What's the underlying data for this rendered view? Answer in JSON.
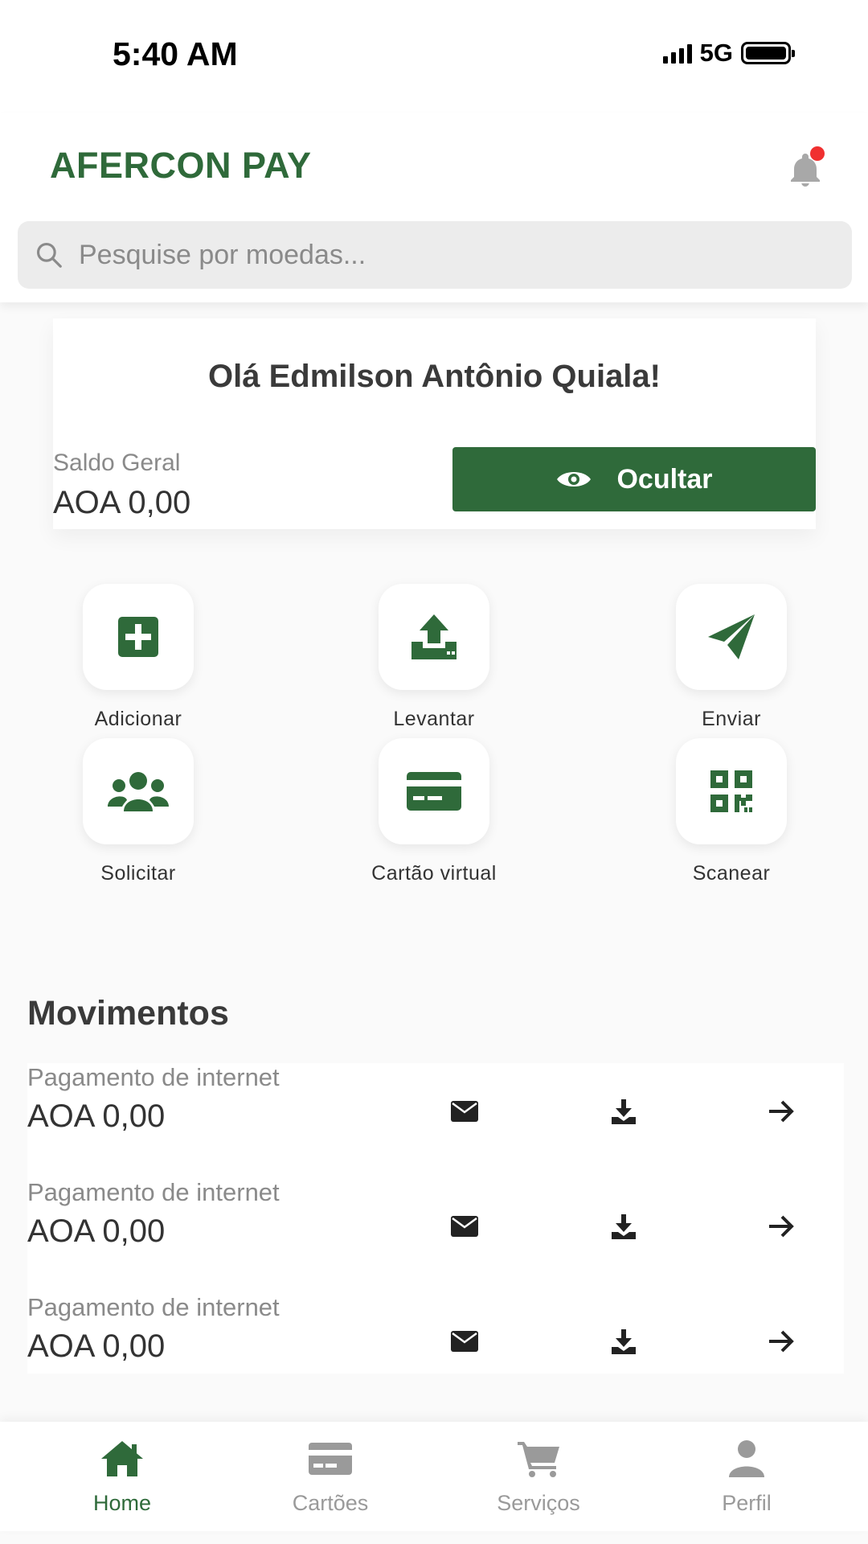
{
  "status": {
    "time": "5:40 AM",
    "network": "5G"
  },
  "header": {
    "title": "AFERCON PAY"
  },
  "search": {
    "placeholder": "Pesquise por moedas..."
  },
  "balance_card": {
    "greeting": "Olá Edmilson Antônio Quiala!",
    "balance_label": "Saldo Geral",
    "balance_value": "AOA 0,00",
    "hide_button_label": "Ocultar"
  },
  "actions": [
    {
      "label": "Adicionar",
      "icon": "plus-square-icon"
    },
    {
      "label": "Levantar",
      "icon": "upload-icon"
    },
    {
      "label": "Enviar",
      "icon": "paper-plane-icon"
    },
    {
      "label": "Solicitar",
      "icon": "users-icon"
    },
    {
      "label": "Cartão virtual",
      "icon": "credit-card-icon"
    },
    {
      "label": "Scanear",
      "icon": "qr-code-icon"
    }
  ],
  "movements": {
    "title": "Movimentos",
    "items": [
      {
        "label": "Pagamento de internet",
        "value": "AOA 0,00"
      },
      {
        "label": "Pagamento de internet",
        "value": "AOA 0,00"
      },
      {
        "label": "Pagamento de internet",
        "value": "AOA 0,00"
      }
    ]
  },
  "bottom_nav": [
    {
      "label": "Home",
      "icon": "home-icon",
      "active": true
    },
    {
      "label": "Cartões",
      "icon": "card-icon",
      "active": false
    },
    {
      "label": "Serviços",
      "icon": "cart-icon",
      "active": false
    },
    {
      "label": "Perfil",
      "icon": "user-icon",
      "active": false
    }
  ],
  "colors": {
    "brand": "#2f6a3a",
    "notification": "#f03030",
    "inactive": "#9a9a9a"
  }
}
